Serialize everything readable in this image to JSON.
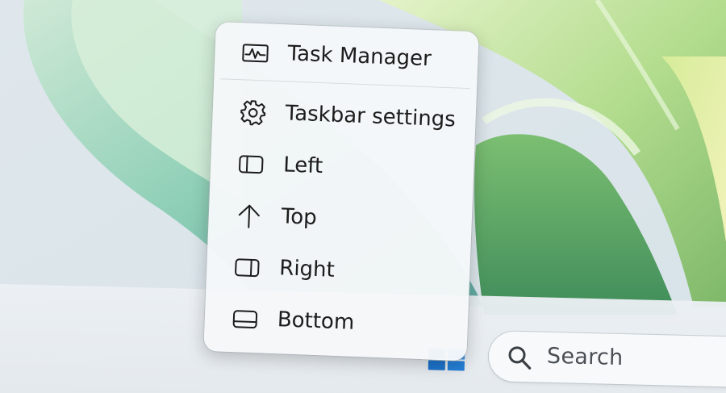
{
  "context_menu": {
    "items": [
      {
        "label": "Task Manager",
        "icon": "task-manager-icon"
      },
      {
        "label": "Taskbar settings",
        "icon": "gear-icon"
      },
      {
        "label": "Left",
        "icon": "left-align-icon"
      },
      {
        "label": "Top",
        "icon": "arrow-up-icon"
      },
      {
        "label": "Right",
        "icon": "right-align-icon"
      },
      {
        "label": "Bottom",
        "icon": "bottom-align-icon"
      }
    ]
  },
  "taskbar": {
    "search": {
      "label": "Search",
      "icon": "search-icon"
    },
    "start": {
      "icon": "windows-logo-icon"
    }
  },
  "colors": {
    "menu_background": "#f5f7f9",
    "menu_text": "#1c1c1c",
    "taskbar_background": "#e9edf1",
    "start_blue": "#1a7fd9",
    "wallpaper_green": "#a9d68c",
    "wallpaper_teal": "#7fc7b8",
    "wallpaper_blue": "#2a62c9"
  }
}
